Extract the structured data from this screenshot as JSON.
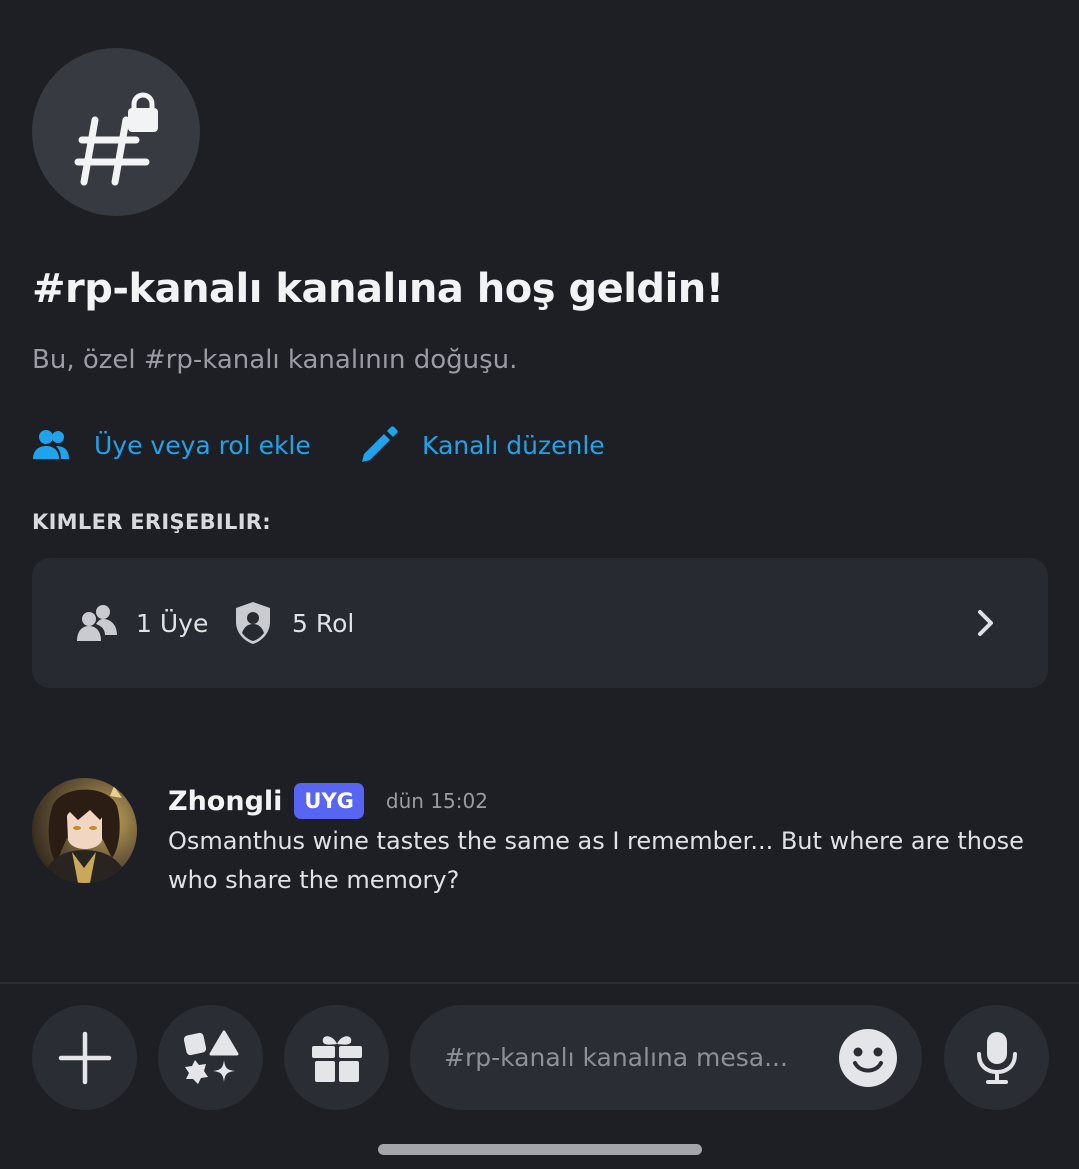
{
  "channel": {
    "icon": "hashtag-lock-icon",
    "welcome_title": "#rp-kanalı kanalına hoş geldin!",
    "welcome_subtitle": "Bu, özel #rp-kanalı kanalının doğuşu."
  },
  "actions": {
    "add_member": {
      "icon": "add-user-icon",
      "label": "Üye veya rol ekle"
    },
    "edit_channel": {
      "icon": "pencil-icon",
      "label": "Kanalı düzenle"
    }
  },
  "access": {
    "header": "KIMLER ERIŞEBILIR:",
    "members": {
      "icon": "members-icon",
      "label": "1 Üye"
    },
    "roles": {
      "icon": "shield-icon",
      "label": "5 Rol"
    },
    "chevron": "chevron-right-icon"
  },
  "message": {
    "author": "Zhongli",
    "tag": "UYG",
    "timestamp": "dün 15:02",
    "text": "Osmanthus wine tastes the same as I remember... But where are those who share the memory?"
  },
  "composer": {
    "placeholder": "#rp-kanalı kanalına mesa...",
    "buttons": [
      "plus-icon",
      "apps-icon",
      "gift-icon",
      "emoji-icon",
      "microphone-icon"
    ]
  },
  "colors": {
    "background": "#1e1f24",
    "accent_link": "#1ea3ec",
    "tag_blurple": "#5865f2",
    "card": "#282a32"
  }
}
